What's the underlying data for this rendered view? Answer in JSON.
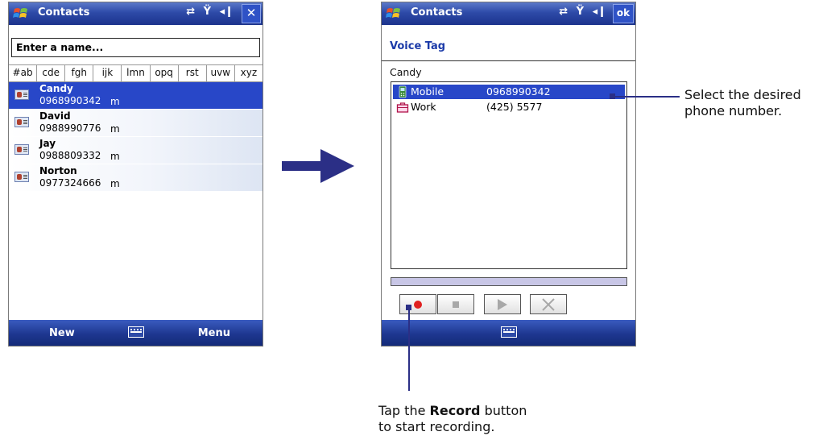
{
  "left_screen": {
    "title": "Contacts",
    "status_icons": "⇄ Ÿ ◂ǀ",
    "close_label": "✕",
    "search_placeholder": "Enter a name...",
    "alpha_tabs": [
      "#ab",
      "cde",
      "fgh",
      "ijk",
      "lmn",
      "opq",
      "rst",
      "uvw",
      "xyz"
    ],
    "contacts": [
      {
        "name": "Candy",
        "phone": "0968990342",
        "type": "m",
        "selected": true
      },
      {
        "name": "David",
        "phone": "0988990776",
        "type": "m",
        "selected": false
      },
      {
        "name": "Jay",
        "phone": "0988809332",
        "type": "m",
        "selected": false
      },
      {
        "name": "Norton",
        "phone": "0977324666",
        "type": "m",
        "selected": false
      }
    ],
    "softkeys": {
      "left": "New",
      "right": "Menu"
    }
  },
  "right_screen": {
    "title": "Contacts",
    "status_icons": "⇄ Ÿ ◂ǀ",
    "ok_label": "ok",
    "section_title": "Voice Tag",
    "person_name": "Candy",
    "numbers": [
      {
        "label": "Mobile",
        "number": "0968990342",
        "icon": "mobile-phone-icon",
        "selected": true
      },
      {
        "label": "Work",
        "number": "(425) 5577",
        "icon": "work-briefcase-icon",
        "selected": false
      }
    ]
  },
  "callouts": {
    "select_phone": [
      "Select the desired",
      "phone number."
    ],
    "record_prefix": "Tap the ",
    "record_bold": "Record",
    "record_suffix": " button",
    "record_line2": "to start recording."
  },
  "colors": {
    "selection": "#2847c8",
    "titlebar": "#2d4aa8",
    "arrow": "#2b2f86",
    "record_dot": "#e02020"
  }
}
